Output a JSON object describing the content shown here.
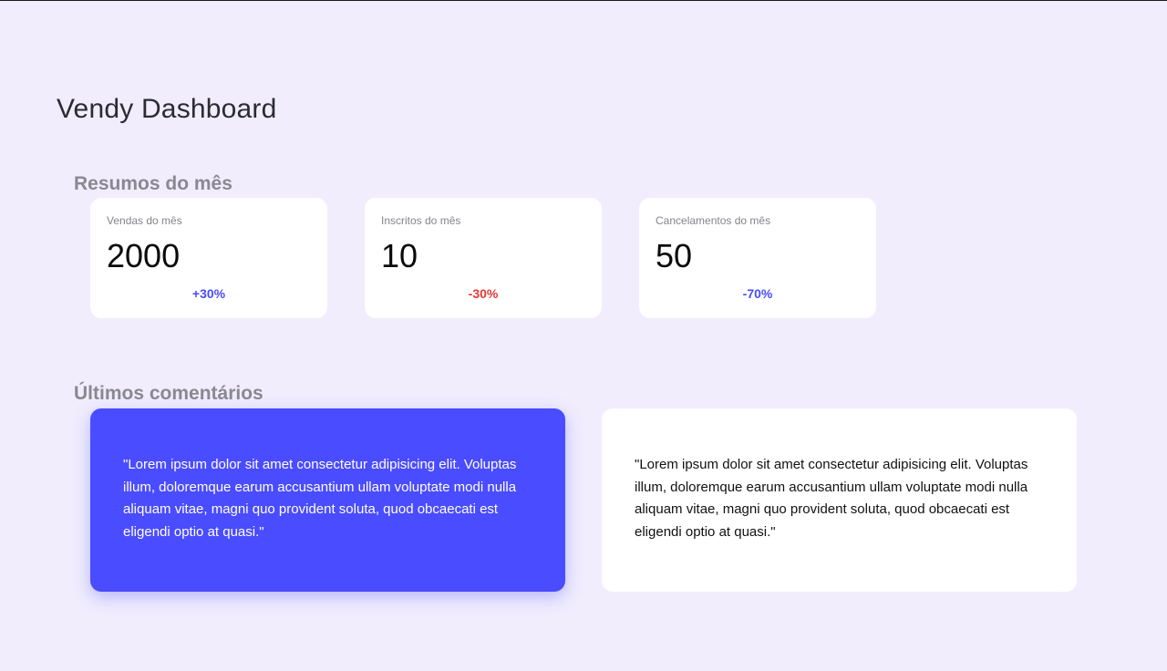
{
  "app": {
    "title": "Vendy Dashboard"
  },
  "summary": {
    "title": "Resumos do mês",
    "cards": [
      {
        "label": "Vendas do mês",
        "value": "2000",
        "change": "+30%",
        "change_color": "#4a4cff"
      },
      {
        "label": "Inscritos do mês",
        "value": "10",
        "change": "-30%",
        "change_color": "#e53935"
      },
      {
        "label": "Cancelamentos do mês",
        "value": "50",
        "change": "-70%",
        "change_color": "#4a4cff"
      }
    ]
  },
  "comments": {
    "title": "Últimos comentários",
    "items": [
      {
        "text": "\"Lorem ipsum dolor sit amet consectetur adipisicing elit. Voluptas illum, doloremque earum accusantium ullam voluptate modi nulla aliquam vitae, magni quo provident soluta, quod obcaecati est eligendi optio at quasi.\"",
        "style": "highlight"
      },
      {
        "text": "\"Lorem ipsum dolor sit amet consectetur adipisicing elit. Voluptas illum, doloremque earum accusantium ullam voluptate modi nulla aliquam vitae, magni quo provident soluta, quod obcaecati est eligendi optio at quasi.\"",
        "style": "plain"
      }
    ]
  },
  "colors": {
    "background": "#f1edfd",
    "accent": "#4a4cff",
    "negative": "#e53935",
    "card": "#ffffff"
  }
}
